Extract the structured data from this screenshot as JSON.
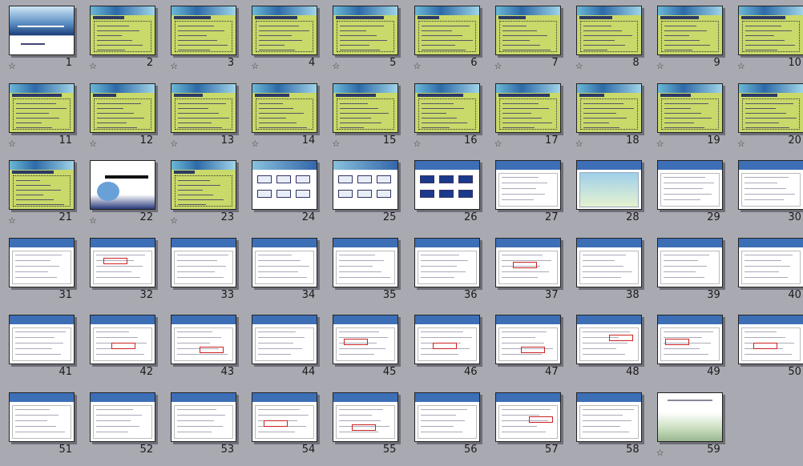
{
  "app": {
    "view": "slide-sorter"
  },
  "colors": {
    "background": "#a9a9b1",
    "green_slide": "#c9d96a",
    "blue_band": "#3d6fb7",
    "white_slide": "#ffffff",
    "dark_title": "#2b3a66",
    "red_mark": "#cc2222"
  },
  "icons": {
    "transition": "star-outline-icon"
  },
  "slides": [
    {
      "number": "1",
      "style": "title",
      "star": true
    },
    {
      "number": "2",
      "style": "green",
      "star": true
    },
    {
      "number": "3",
      "style": "green",
      "star": true
    },
    {
      "number": "4",
      "style": "green",
      "star": true
    },
    {
      "number": "5",
      "style": "green",
      "star": true
    },
    {
      "number": "6",
      "style": "green",
      "star": true
    },
    {
      "number": "7",
      "style": "green",
      "star": true
    },
    {
      "number": "8",
      "style": "green",
      "star": true
    },
    {
      "number": "9",
      "style": "green",
      "star": true
    },
    {
      "number": "10",
      "style": "green",
      "star": true
    },
    {
      "number": "11",
      "style": "green",
      "star": true
    },
    {
      "number": "12",
      "style": "green",
      "star": true
    },
    {
      "number": "13",
      "style": "green",
      "star": true
    },
    {
      "number": "14",
      "style": "green",
      "star": true
    },
    {
      "number": "15",
      "style": "green",
      "star": true
    },
    {
      "number": "16",
      "style": "green",
      "star": true
    },
    {
      "number": "17",
      "style": "green",
      "star": true
    },
    {
      "number": "18",
      "style": "green",
      "star": true
    },
    {
      "number": "19",
      "style": "green",
      "star": true
    },
    {
      "number": "20",
      "style": "green",
      "star": true
    },
    {
      "number": "21",
      "style": "green",
      "star": true
    },
    {
      "number": "22",
      "style": "section",
      "star": true
    },
    {
      "number": "23",
      "style": "green-list",
      "star": true
    },
    {
      "number": "24",
      "style": "diagram",
      "star": false
    },
    {
      "number": "25",
      "style": "diagram",
      "star": false
    },
    {
      "number": "26",
      "style": "blue-diagram",
      "star": false
    },
    {
      "number": "27",
      "style": "web",
      "star": false
    },
    {
      "number": "28",
      "style": "photo-web",
      "star": false
    },
    {
      "number": "29",
      "style": "web",
      "star": false
    },
    {
      "number": "30",
      "style": "web",
      "star": false
    },
    {
      "number": "31",
      "style": "web",
      "star": false
    },
    {
      "number": "32",
      "style": "web-red",
      "star": false
    },
    {
      "number": "33",
      "style": "web",
      "star": false
    },
    {
      "number": "34",
      "style": "web",
      "star": false
    },
    {
      "number": "35",
      "style": "web",
      "star": false
    },
    {
      "number": "36",
      "style": "web",
      "star": false
    },
    {
      "number": "37",
      "style": "web-red",
      "star": false
    },
    {
      "number": "38",
      "style": "web",
      "star": false
    },
    {
      "number": "39",
      "style": "web",
      "star": false
    },
    {
      "number": "40",
      "style": "web",
      "star": false
    },
    {
      "number": "41",
      "style": "web",
      "star": false
    },
    {
      "number": "42",
      "style": "web-red",
      "star": false
    },
    {
      "number": "43",
      "style": "web-red",
      "star": false
    },
    {
      "number": "44",
      "style": "web",
      "star": false
    },
    {
      "number": "45",
      "style": "web-red",
      "star": false
    },
    {
      "number": "46",
      "style": "web-red",
      "star": false
    },
    {
      "number": "47",
      "style": "web-red",
      "star": false
    },
    {
      "number": "48",
      "style": "web-red",
      "star": false
    },
    {
      "number": "49",
      "style": "web-red",
      "star": false
    },
    {
      "number": "50",
      "style": "web-red",
      "star": false
    },
    {
      "number": "51",
      "style": "web",
      "star": false
    },
    {
      "number": "52",
      "style": "web",
      "star": false
    },
    {
      "number": "53",
      "style": "web",
      "star": false
    },
    {
      "number": "54",
      "style": "web-red",
      "star": false
    },
    {
      "number": "55",
      "style": "web-red",
      "star": false
    },
    {
      "number": "56",
      "style": "web",
      "star": false
    },
    {
      "number": "57",
      "style": "web-red",
      "star": false
    },
    {
      "number": "58",
      "style": "web",
      "star": false
    },
    {
      "number": "59",
      "style": "closing",
      "star": true
    }
  ]
}
